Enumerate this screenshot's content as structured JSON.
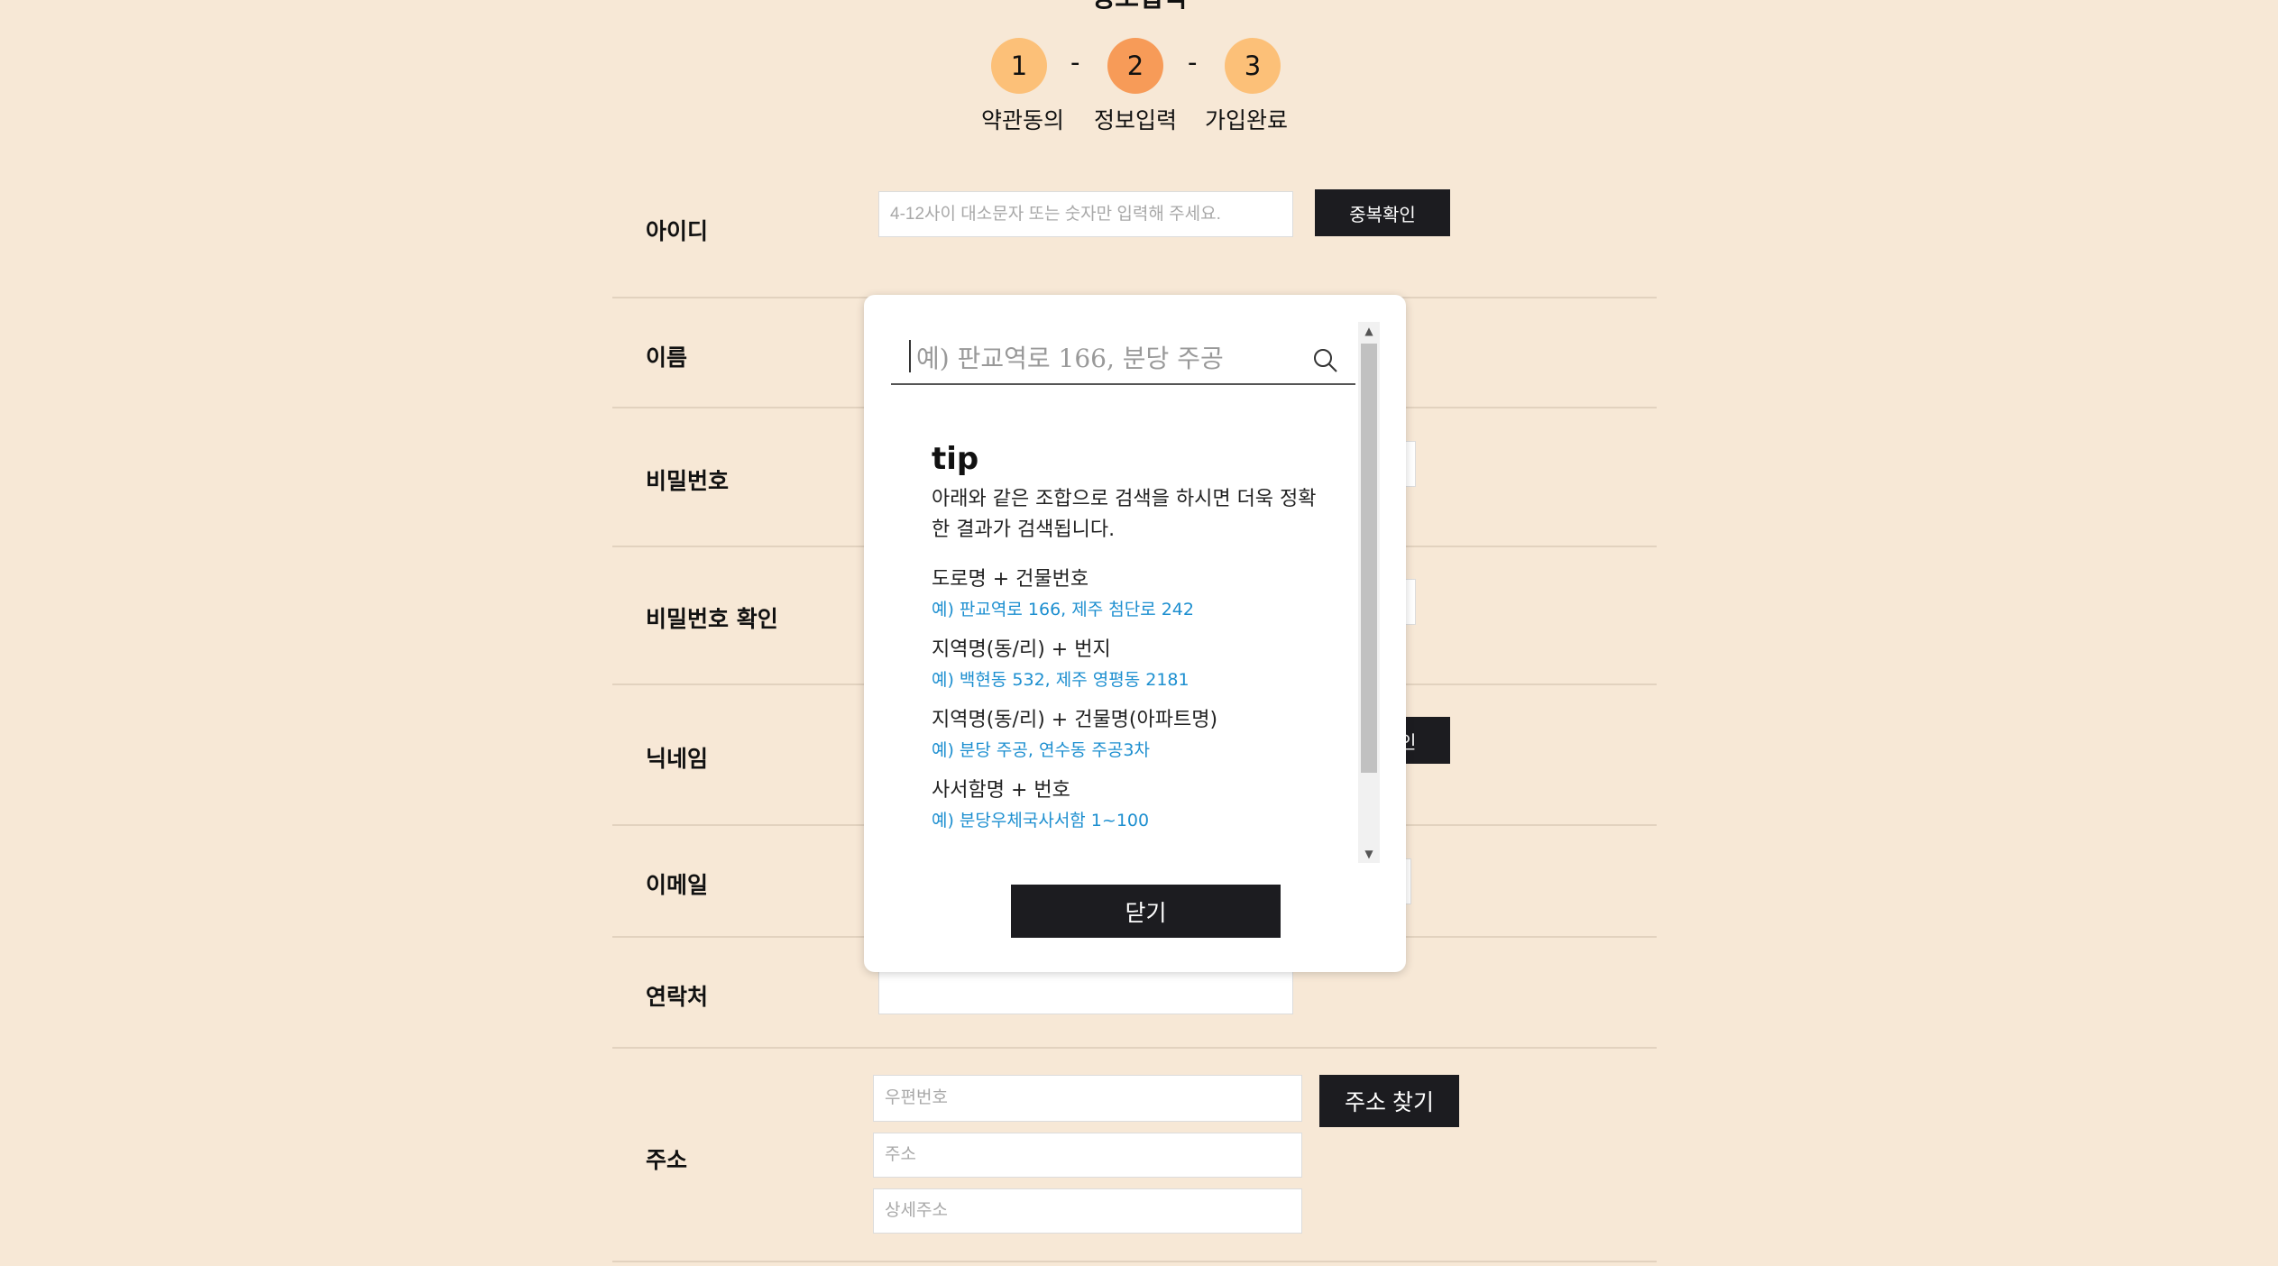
{
  "page": {
    "title": "정보입력"
  },
  "steps": [
    {
      "number": "1",
      "label": "약관동의"
    },
    {
      "number": "2",
      "label": "정보입력"
    },
    {
      "number": "3",
      "label": "가입완료"
    }
  ],
  "step_separator": "-",
  "form": {
    "id_label": "아이디",
    "id_placeholder": "4-12사이 대소문자 또는 숫자만 입력해 주세요.",
    "id_check_button": "중복확인",
    "name_label": "이름",
    "password_label": "비밀번호",
    "password_confirm_label": "비밀번호 확인",
    "nickname_label": "닉네임",
    "nickname_check_button_partial": "인",
    "email_label": "이메일",
    "phone_label": "연락처",
    "address_label": "주소",
    "zipcode_placeholder": "우편번호",
    "address_placeholder": "주소",
    "address_detail_placeholder": "상세주소",
    "address_search_button": "주소 찾기"
  },
  "modal": {
    "search_placeholder": "예) 판교역로 166, 분당 주공",
    "tip_title": "tip",
    "tip_description": "아래와 같은 조합으로 검색을 하시면 더욱 정확한 결과가 검색됩니다.",
    "tips": [
      {
        "title": "도로명 + 건물번호",
        "example": "예) 판교역로 166,  제주 첨단로 242"
      },
      {
        "title": "지역명(동/리) + 번지",
        "example": "예) 백현동 532,  제주 영평동 2181"
      },
      {
        "title": "지역명(동/리) + 건물명(아파트명)",
        "example": "예) 분당 주공,  연수동 주공3차"
      },
      {
        "title": "사서함명 + 번호",
        "example": "예) 분당우체국사서함 1~100"
      }
    ],
    "close_button": "닫기"
  },
  "colors": {
    "background": "#f7e8d6",
    "step_inactive": "#fcc078",
    "step_active": "#f79b58",
    "dark_button": "#1c1c20",
    "example_text": "#1d8fd0"
  }
}
